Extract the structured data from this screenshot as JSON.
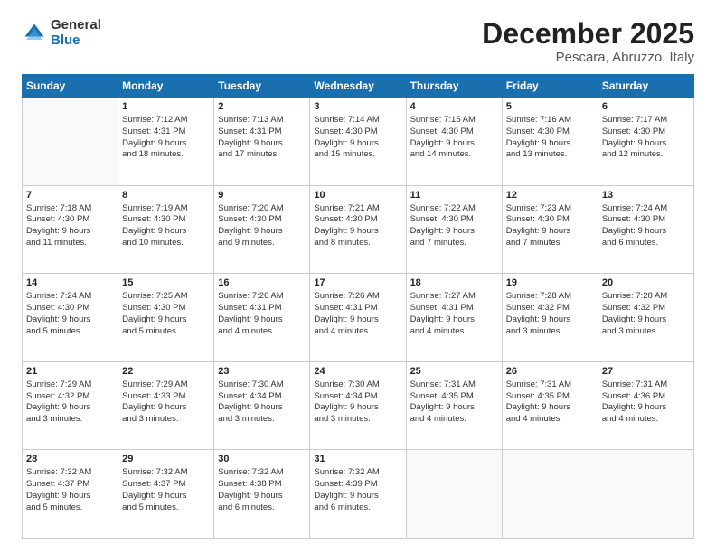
{
  "logo": {
    "general": "General",
    "blue": "Blue"
  },
  "header": {
    "month": "December 2025",
    "location": "Pescara, Abruzzo, Italy"
  },
  "weekdays": [
    "Sunday",
    "Monday",
    "Tuesday",
    "Wednesday",
    "Thursday",
    "Friday",
    "Saturday"
  ],
  "weeks": [
    [
      {
        "day": "",
        "info": ""
      },
      {
        "day": "1",
        "info": "Sunrise: 7:12 AM\nSunset: 4:31 PM\nDaylight: 9 hours\nand 18 minutes."
      },
      {
        "day": "2",
        "info": "Sunrise: 7:13 AM\nSunset: 4:31 PM\nDaylight: 9 hours\nand 17 minutes."
      },
      {
        "day": "3",
        "info": "Sunrise: 7:14 AM\nSunset: 4:30 PM\nDaylight: 9 hours\nand 15 minutes."
      },
      {
        "day": "4",
        "info": "Sunrise: 7:15 AM\nSunset: 4:30 PM\nDaylight: 9 hours\nand 14 minutes."
      },
      {
        "day": "5",
        "info": "Sunrise: 7:16 AM\nSunset: 4:30 PM\nDaylight: 9 hours\nand 13 minutes."
      },
      {
        "day": "6",
        "info": "Sunrise: 7:17 AM\nSunset: 4:30 PM\nDaylight: 9 hours\nand 12 minutes."
      }
    ],
    [
      {
        "day": "7",
        "info": "Sunrise: 7:18 AM\nSunset: 4:30 PM\nDaylight: 9 hours\nand 11 minutes."
      },
      {
        "day": "8",
        "info": "Sunrise: 7:19 AM\nSunset: 4:30 PM\nDaylight: 9 hours\nand 10 minutes."
      },
      {
        "day": "9",
        "info": "Sunrise: 7:20 AM\nSunset: 4:30 PM\nDaylight: 9 hours\nand 9 minutes."
      },
      {
        "day": "10",
        "info": "Sunrise: 7:21 AM\nSunset: 4:30 PM\nDaylight: 9 hours\nand 8 minutes."
      },
      {
        "day": "11",
        "info": "Sunrise: 7:22 AM\nSunset: 4:30 PM\nDaylight: 9 hours\nand 7 minutes."
      },
      {
        "day": "12",
        "info": "Sunrise: 7:23 AM\nSunset: 4:30 PM\nDaylight: 9 hours\nand 7 minutes."
      },
      {
        "day": "13",
        "info": "Sunrise: 7:24 AM\nSunset: 4:30 PM\nDaylight: 9 hours\nand 6 minutes."
      }
    ],
    [
      {
        "day": "14",
        "info": "Sunrise: 7:24 AM\nSunset: 4:30 PM\nDaylight: 9 hours\nand 5 minutes."
      },
      {
        "day": "15",
        "info": "Sunrise: 7:25 AM\nSunset: 4:30 PM\nDaylight: 9 hours\nand 5 minutes."
      },
      {
        "day": "16",
        "info": "Sunrise: 7:26 AM\nSunset: 4:31 PM\nDaylight: 9 hours\nand 4 minutes."
      },
      {
        "day": "17",
        "info": "Sunrise: 7:26 AM\nSunset: 4:31 PM\nDaylight: 9 hours\nand 4 minutes."
      },
      {
        "day": "18",
        "info": "Sunrise: 7:27 AM\nSunset: 4:31 PM\nDaylight: 9 hours\nand 4 minutes."
      },
      {
        "day": "19",
        "info": "Sunrise: 7:28 AM\nSunset: 4:32 PM\nDaylight: 9 hours\nand 3 minutes."
      },
      {
        "day": "20",
        "info": "Sunrise: 7:28 AM\nSunset: 4:32 PM\nDaylight: 9 hours\nand 3 minutes."
      }
    ],
    [
      {
        "day": "21",
        "info": "Sunrise: 7:29 AM\nSunset: 4:32 PM\nDaylight: 9 hours\nand 3 minutes."
      },
      {
        "day": "22",
        "info": "Sunrise: 7:29 AM\nSunset: 4:33 PM\nDaylight: 9 hours\nand 3 minutes."
      },
      {
        "day": "23",
        "info": "Sunrise: 7:30 AM\nSunset: 4:34 PM\nDaylight: 9 hours\nand 3 minutes."
      },
      {
        "day": "24",
        "info": "Sunrise: 7:30 AM\nSunset: 4:34 PM\nDaylight: 9 hours\nand 3 minutes."
      },
      {
        "day": "25",
        "info": "Sunrise: 7:31 AM\nSunset: 4:35 PM\nDaylight: 9 hours\nand 4 minutes."
      },
      {
        "day": "26",
        "info": "Sunrise: 7:31 AM\nSunset: 4:35 PM\nDaylight: 9 hours\nand 4 minutes."
      },
      {
        "day": "27",
        "info": "Sunrise: 7:31 AM\nSunset: 4:36 PM\nDaylight: 9 hours\nand 4 minutes."
      }
    ],
    [
      {
        "day": "28",
        "info": "Sunrise: 7:32 AM\nSunset: 4:37 PM\nDaylight: 9 hours\nand 5 minutes."
      },
      {
        "day": "29",
        "info": "Sunrise: 7:32 AM\nSunset: 4:37 PM\nDaylight: 9 hours\nand 5 minutes."
      },
      {
        "day": "30",
        "info": "Sunrise: 7:32 AM\nSunset: 4:38 PM\nDaylight: 9 hours\nand 6 minutes."
      },
      {
        "day": "31",
        "info": "Sunrise: 7:32 AM\nSunset: 4:39 PM\nDaylight: 9 hours\nand 6 minutes."
      },
      {
        "day": "",
        "info": ""
      },
      {
        "day": "",
        "info": ""
      },
      {
        "day": "",
        "info": ""
      }
    ]
  ]
}
